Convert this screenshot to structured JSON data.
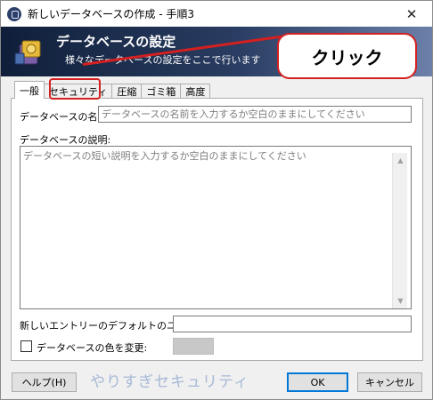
{
  "window": {
    "title": "新しいデータベースの作成 - 手順3",
    "close_glyph": "✕"
  },
  "banner": {
    "title": "データベースの設定",
    "subtitle": "様々なデータベースの設定をここで行います"
  },
  "annotation": {
    "callout_text": "クリック",
    "color": "#d42020"
  },
  "tabs": [
    {
      "label": "一般",
      "selected": true
    },
    {
      "label": "セキュリティ",
      "selected": false
    },
    {
      "label": "圧縮",
      "selected": false
    },
    {
      "label": "ゴミ箱",
      "selected": false
    },
    {
      "label": "高度",
      "selected": false
    }
  ],
  "general": {
    "name_label": "データベースの名前:",
    "name_placeholder": "データベースの名前を入力するか空白のままにしてください",
    "description_label": "データベースの説明:",
    "description_placeholder": "データベースの短い説明を入力するか空白のままにしてください",
    "default_user_label": "新しいエントリーのデフォルトのユーザー名:",
    "default_user_value": "",
    "color_checkbox_label": "データベースの色を変更:",
    "color_checked": false,
    "swatch_color": "#c8c8c8"
  },
  "buttons": {
    "help": "ヘルプ(H)",
    "ok": "OK",
    "cancel": "キャンセル"
  },
  "watermark": "やりすぎセキュリティ"
}
